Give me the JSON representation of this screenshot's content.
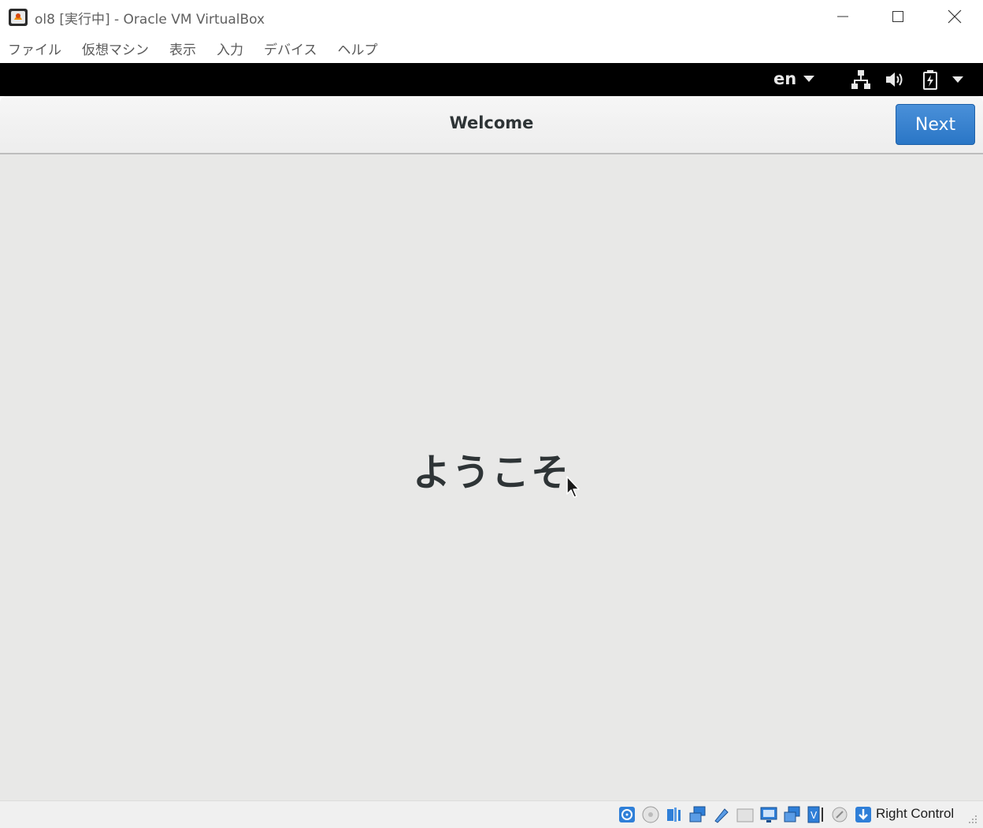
{
  "window": {
    "title": "ol8 [実行中] - Oracle VM VirtualBox"
  },
  "menubar": {
    "items": [
      {
        "label": "ファイル"
      },
      {
        "label": "仮想マシン"
      },
      {
        "label": "表示"
      },
      {
        "label": "入力"
      },
      {
        "label": "デバイス"
      },
      {
        "label": "ヘルプ"
      }
    ]
  },
  "gnome_topbar": {
    "language": "en"
  },
  "headerbar": {
    "title": "Welcome",
    "next_label": "Next",
    "accent": "#3584e4"
  },
  "main": {
    "welcome_text": "ようこそ"
  },
  "statusbar": {
    "host_key": "Right Control",
    "icons": [
      "hard-disk-icon",
      "optical-drive-icon",
      "audio-icon",
      "network-icon",
      "usb-icon",
      "shared-folders-icon",
      "display-icon",
      "video-capture-icon",
      "vt-x-icon",
      "mouse-integration-icon",
      "keyboard-capture-icon"
    ]
  }
}
